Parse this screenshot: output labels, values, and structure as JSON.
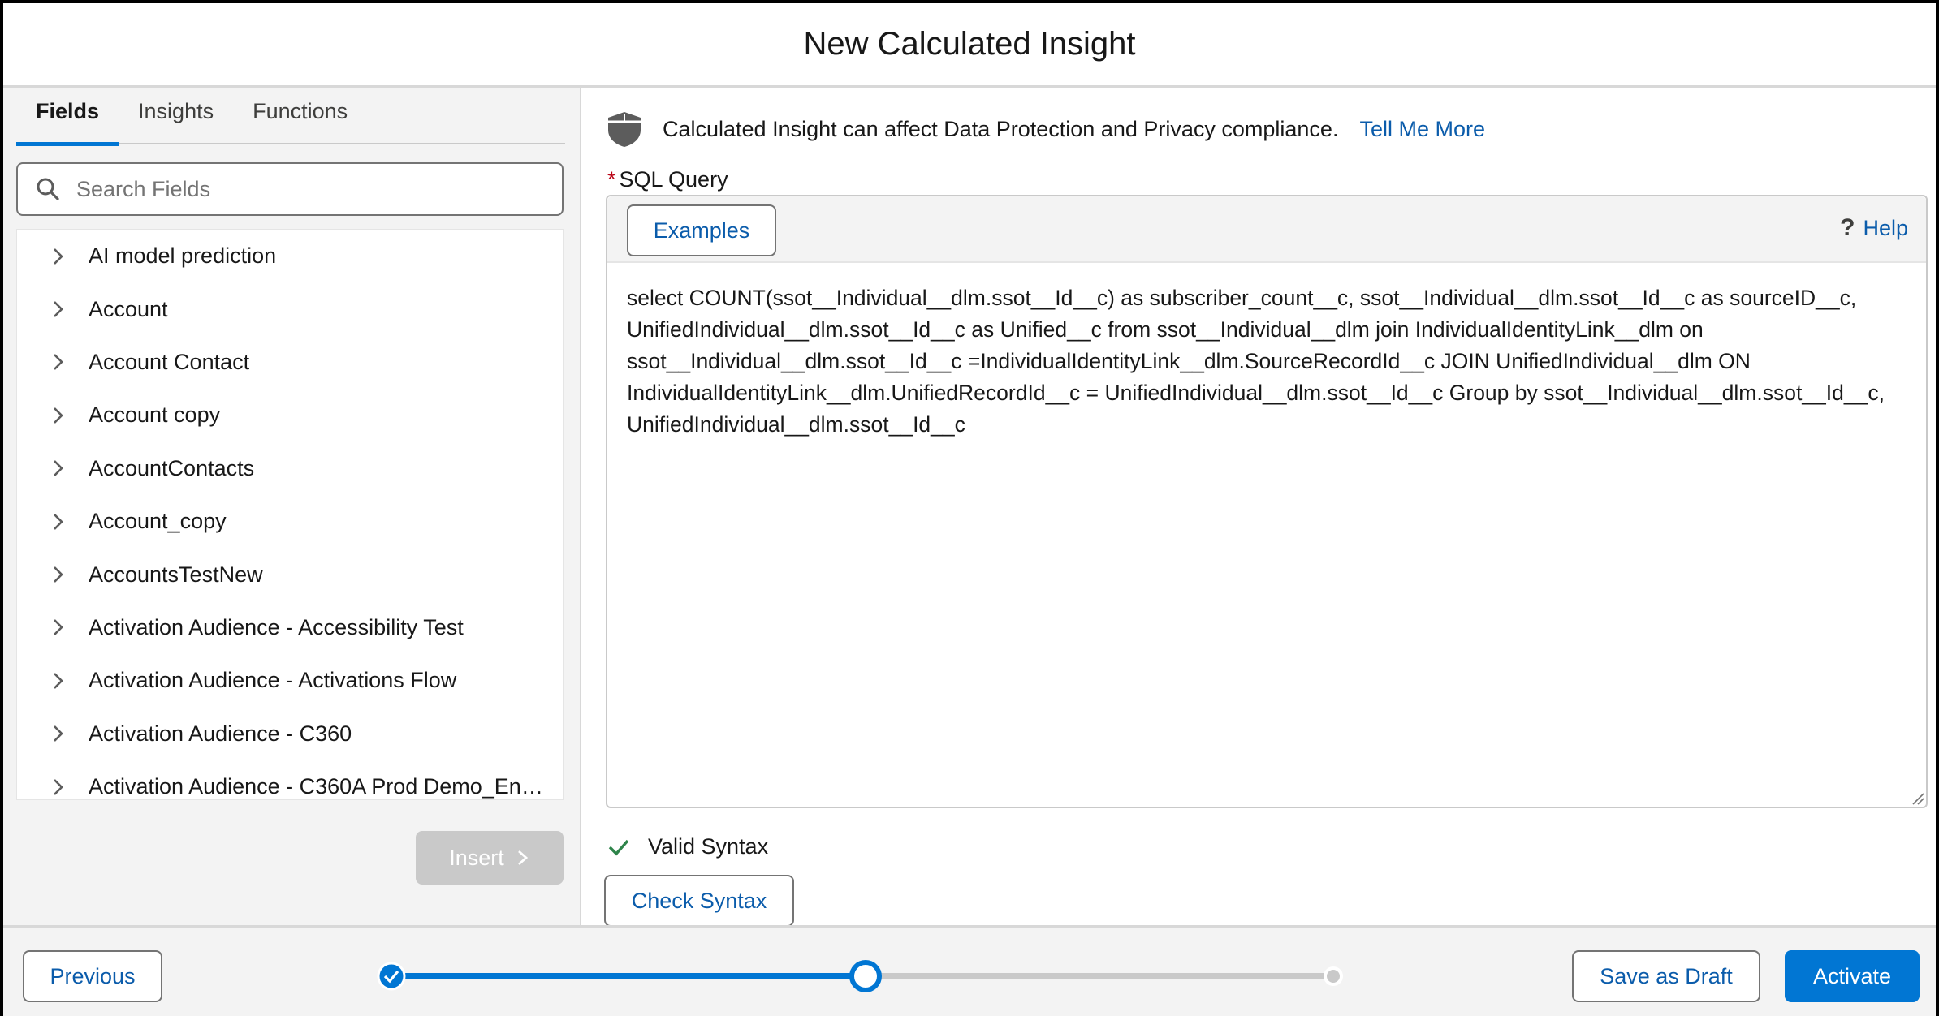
{
  "header": {
    "title": "New Calculated Insight"
  },
  "left": {
    "tabs": [
      {
        "label": "Fields",
        "active": true
      },
      {
        "label": "Insights",
        "active": false
      },
      {
        "label": "Functions",
        "active": false
      }
    ],
    "search": {
      "placeholder": "Search Fields",
      "value": ""
    },
    "items": [
      {
        "label": "AI model prediction"
      },
      {
        "label": "Account"
      },
      {
        "label": "Account Contact"
      },
      {
        "label": "Account copy"
      },
      {
        "label": "AccountContacts"
      },
      {
        "label": "Account_copy"
      },
      {
        "label": "AccountsTestNew"
      },
      {
        "label": "Activation Audience - Accessibility Test"
      },
      {
        "label": "Activation Audience - Activations Flow"
      },
      {
        "label": "Activation Audience - C360"
      },
      {
        "label": "Activation Audience - C360A Prod Demo_Enablement"
      }
    ],
    "insert_label": "Insert"
  },
  "right": {
    "notice_text": "Calculated Insight can affect Data Protection and Privacy compliance.",
    "notice_link": "Tell Me More",
    "sql_label": "SQL Query",
    "required_marker": "*",
    "examples_label": "Examples",
    "help_label": "Help",
    "query": "select COUNT(ssot__Individual__dlm.ssot__Id__c) as subscriber_count__c, ssot__Individual__dlm.ssot__Id__c as sourceID__c, UnifiedIndividual__dlm.ssot__Id__c as Unified__c from ssot__Individual__dlm join IndividualIdentityLink__dlm on ssot__Individual__dlm.ssot__Id__c =IndividualIdentityLink__dlm.SourceRecordId__c JOIN UnifiedIndividual__dlm ON IndividualIdentityLink__dlm.UnifiedRecordId__c = UnifiedIndividual__dlm.ssot__Id__c Group by ssot__Individual__dlm.ssot__Id__c, UnifiedIndividual__dlm.ssot__Id__c",
    "valid_text": "Valid Syntax",
    "check_label": "Check Syntax"
  },
  "footer": {
    "previous_label": "Previous",
    "save_draft_label": "Save as Draft",
    "activate_label": "Activate",
    "progress": {
      "steps": 3,
      "current_step": 2,
      "completed_steps": 1
    }
  },
  "colors": {
    "brand": "#0176d3",
    "link": "#0b5cab",
    "success": "#2e844a",
    "required": "#ba0517",
    "disabled": "#c9c9c9"
  },
  "icons": {
    "search": "search-icon",
    "chevron": "chevron-right-icon",
    "shield": "shield-icon",
    "help": "help-icon",
    "check": "check-icon"
  }
}
